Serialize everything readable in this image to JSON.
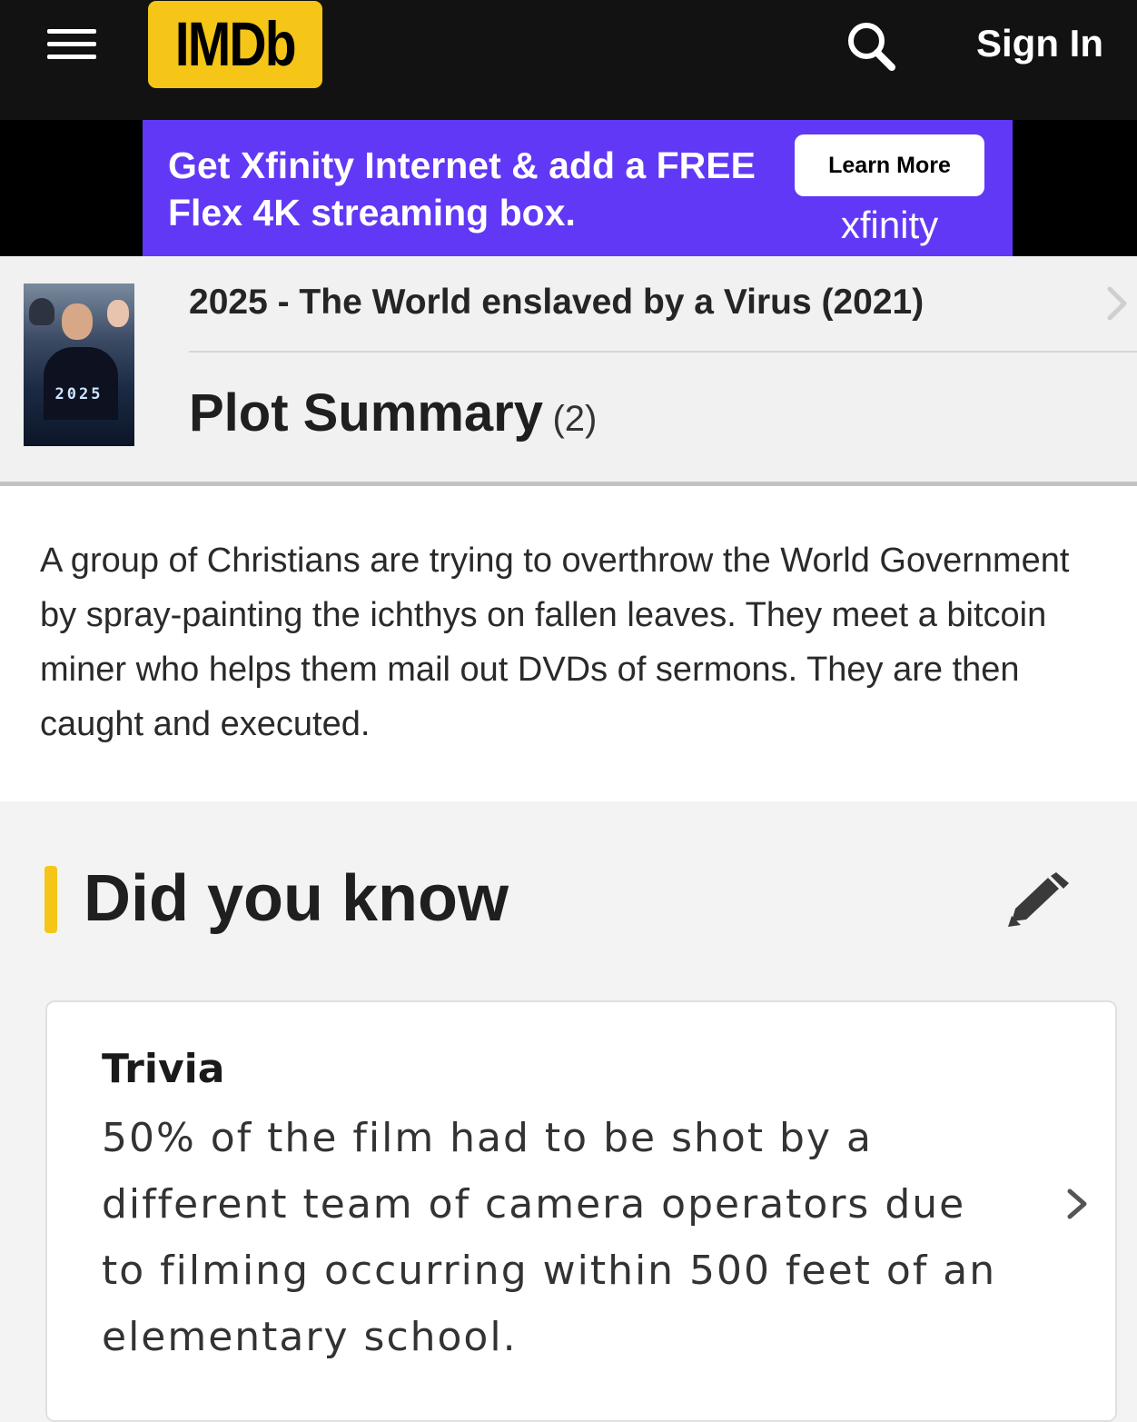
{
  "nav": {
    "logo_text": "IMDb",
    "signin_label": "Sign In",
    "menu_icon": "hamburger-menu-icon",
    "search_icon": "search-icon"
  },
  "ad": {
    "headline": "Get Xfinity Internet & add a FREE Flex 4K streaming box.",
    "cta_label": "Learn More",
    "brand": "xfinity",
    "background_color": "#6138f5"
  },
  "title": {
    "movie_title": "2025 - The World enslaved by a Virus (2021)",
    "section_title": "Plot Summary",
    "section_count": "(2)",
    "poster_year": "2025"
  },
  "plot": {
    "summary": "A group of Christians are trying to overthrow the World Government by spray-painting the ichthys on fallen leaves. They meet a bitcoin miner who helps them mail out DVDs of sermons. They are then caught and executed."
  },
  "did_you_know": {
    "heading": "Did you know",
    "edit_icon": "pencil-icon",
    "accent_color": "#f5c518",
    "trivia": {
      "label": "Trivia",
      "text": "50% of the film had to be shot by a different team of camera operators due to filming occurring within 500 feet of an elementary school."
    }
  }
}
